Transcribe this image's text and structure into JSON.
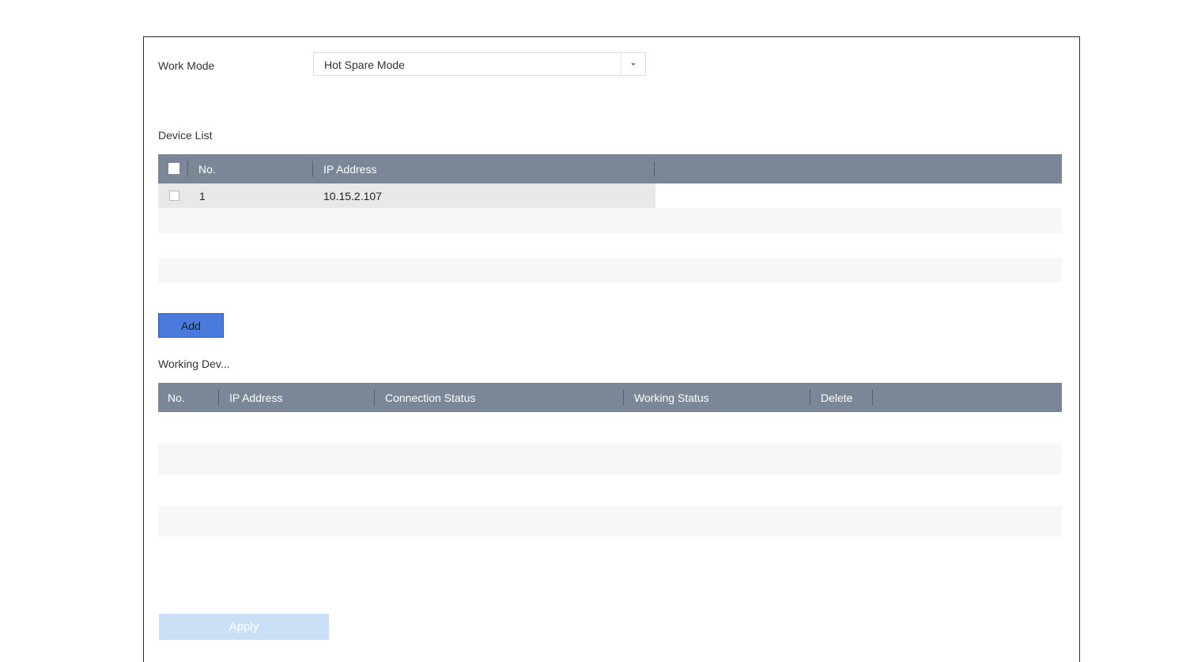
{
  "work_mode": {
    "label": "Work Mode",
    "selected": "Hot Spare Mode"
  },
  "device_list": {
    "title": "Device List",
    "columns": [
      "No.",
      "IP Address"
    ],
    "rows": [
      {
        "no": "1",
        "ip": "10.15.2.107"
      }
    ]
  },
  "add_button": "Add",
  "working_devices": {
    "title": "Working Dev...",
    "columns": [
      "No.",
      "IP Address",
      "Connection Status",
      "Working Status",
      "Delete"
    ]
  },
  "apply_button": "Apply",
  "colors": {
    "header_bg": "#7b8797",
    "add_button_bg": "#4a7bdc",
    "apply_button_bg": "#c9e0f7",
    "row_highlight": "#e8e8e8",
    "row_alt": "#f7f7f7"
  }
}
